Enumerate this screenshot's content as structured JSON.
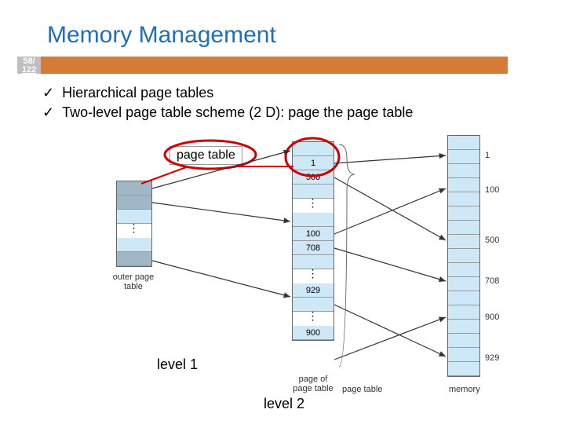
{
  "title": "Memory Management",
  "badge": {
    "top": "58/",
    "bottom": "122"
  },
  "bullets": {
    "b1": "Hierarchical page tables",
    "b2": "Two-level page table scheme (2 D): page the page table"
  },
  "labels": {
    "page_table_box": "page table",
    "level1": "level 1",
    "level2": "level 2",
    "outer_page_table": "outer page\ntable",
    "page_of_page_table": "page of\npage table",
    "page_table_caption": "page table",
    "memory": "memory"
  },
  "diagram": {
    "inner": {
      "cells": [
        "",
        "1",
        "500",
        "",
        "",
        "100",
        "708",
        "",
        "929",
        "",
        "900"
      ]
    },
    "memory": {
      "cells": [
        "",
        "1",
        "",
        "100",
        "",
        "",
        "500",
        "",
        "708",
        "",
        "900",
        "",
        "929",
        ""
      ]
    }
  }
}
